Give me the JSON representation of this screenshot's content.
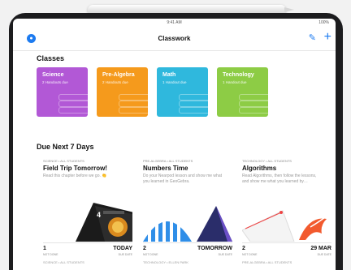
{
  "status_bar": {
    "left": "",
    "time": "9:41 AM",
    "right": "100%"
  },
  "nav": {
    "title": "Classwork",
    "avatar_icon": "person-icon",
    "edit_icon": "edit-icon",
    "add_icon": "plus-icon",
    "accent": "#1d7bf0"
  },
  "sections": {
    "classes": "Classes",
    "due": "Due Next 7 Days"
  },
  "classes": [
    {
      "name": "Science",
      "sub": "2 Handouts due",
      "color": "#b258d6"
    },
    {
      "name": "Pre-Algebra",
      "sub": "2 Handouts due",
      "color": "#f59a1c"
    },
    {
      "name": "Math",
      "sub": "1 Handout due",
      "color": "#2fb8dd"
    },
    {
      "name": "Technology",
      "sub": "1 Handout due",
      "color": "#8dcc45"
    }
  ],
  "due": [
    {
      "label": "Science • All Students",
      "title": "Field Trip Tomorrow!",
      "desc": "Read this chapter before we go. 👏",
      "count": "1",
      "count_label": "Not done",
      "date": "TODAY",
      "date_label": "Due date"
    },
    {
      "label": "Pre-Algebra • All Students",
      "title": "Numbers Time",
      "desc": "Do your Nearpod lesson and show me what you learned in GeoGebra.",
      "count": "2",
      "count_label": "Not done",
      "date": "TOMORROW",
      "date_label": "Due date"
    },
    {
      "label": "Technology • All Students",
      "title": "Algorithms",
      "desc": "Read Algorithms, then follow the lessons, and show me what you learned by…",
      "count": "2",
      "count_label": "Not done",
      "date": "29 MAR",
      "date_label": "Due date"
    }
  ],
  "peek": [
    "Science • All Students",
    "Technology • Ellen Park",
    "Pre-Algebra • All Students"
  ]
}
